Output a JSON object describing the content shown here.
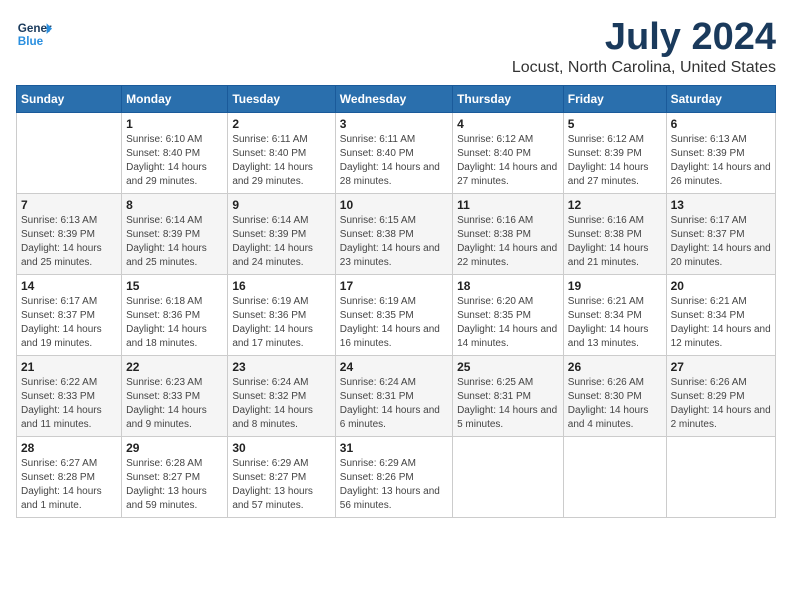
{
  "logo": {
    "line1": "General",
    "line2": "Blue"
  },
  "title": "July 2024",
  "subtitle": "Locust, North Carolina, United States",
  "days_header": [
    "Sunday",
    "Monday",
    "Tuesday",
    "Wednesday",
    "Thursday",
    "Friday",
    "Saturday"
  ],
  "weeks": [
    [
      {
        "num": "",
        "sunrise": "",
        "sunset": "",
        "daylight": ""
      },
      {
        "num": "1",
        "sunrise": "Sunrise: 6:10 AM",
        "sunset": "Sunset: 8:40 PM",
        "daylight": "Daylight: 14 hours and 29 minutes."
      },
      {
        "num": "2",
        "sunrise": "Sunrise: 6:11 AM",
        "sunset": "Sunset: 8:40 PM",
        "daylight": "Daylight: 14 hours and 29 minutes."
      },
      {
        "num": "3",
        "sunrise": "Sunrise: 6:11 AM",
        "sunset": "Sunset: 8:40 PM",
        "daylight": "Daylight: 14 hours and 28 minutes."
      },
      {
        "num": "4",
        "sunrise": "Sunrise: 6:12 AM",
        "sunset": "Sunset: 8:40 PM",
        "daylight": "Daylight: 14 hours and 27 minutes."
      },
      {
        "num": "5",
        "sunrise": "Sunrise: 6:12 AM",
        "sunset": "Sunset: 8:39 PM",
        "daylight": "Daylight: 14 hours and 27 minutes."
      },
      {
        "num": "6",
        "sunrise": "Sunrise: 6:13 AM",
        "sunset": "Sunset: 8:39 PM",
        "daylight": "Daylight: 14 hours and 26 minutes."
      }
    ],
    [
      {
        "num": "7",
        "sunrise": "Sunrise: 6:13 AM",
        "sunset": "Sunset: 8:39 PM",
        "daylight": "Daylight: 14 hours and 25 minutes."
      },
      {
        "num": "8",
        "sunrise": "Sunrise: 6:14 AM",
        "sunset": "Sunset: 8:39 PM",
        "daylight": "Daylight: 14 hours and 25 minutes."
      },
      {
        "num": "9",
        "sunrise": "Sunrise: 6:14 AM",
        "sunset": "Sunset: 8:39 PM",
        "daylight": "Daylight: 14 hours and 24 minutes."
      },
      {
        "num": "10",
        "sunrise": "Sunrise: 6:15 AM",
        "sunset": "Sunset: 8:38 PM",
        "daylight": "Daylight: 14 hours and 23 minutes."
      },
      {
        "num": "11",
        "sunrise": "Sunrise: 6:16 AM",
        "sunset": "Sunset: 8:38 PM",
        "daylight": "Daylight: 14 hours and 22 minutes."
      },
      {
        "num": "12",
        "sunrise": "Sunrise: 6:16 AM",
        "sunset": "Sunset: 8:38 PM",
        "daylight": "Daylight: 14 hours and 21 minutes."
      },
      {
        "num": "13",
        "sunrise": "Sunrise: 6:17 AM",
        "sunset": "Sunset: 8:37 PM",
        "daylight": "Daylight: 14 hours and 20 minutes."
      }
    ],
    [
      {
        "num": "14",
        "sunrise": "Sunrise: 6:17 AM",
        "sunset": "Sunset: 8:37 PM",
        "daylight": "Daylight: 14 hours and 19 minutes."
      },
      {
        "num": "15",
        "sunrise": "Sunrise: 6:18 AM",
        "sunset": "Sunset: 8:36 PM",
        "daylight": "Daylight: 14 hours and 18 minutes."
      },
      {
        "num": "16",
        "sunrise": "Sunrise: 6:19 AM",
        "sunset": "Sunset: 8:36 PM",
        "daylight": "Daylight: 14 hours and 17 minutes."
      },
      {
        "num": "17",
        "sunrise": "Sunrise: 6:19 AM",
        "sunset": "Sunset: 8:35 PM",
        "daylight": "Daylight: 14 hours and 16 minutes."
      },
      {
        "num": "18",
        "sunrise": "Sunrise: 6:20 AM",
        "sunset": "Sunset: 8:35 PM",
        "daylight": "Daylight: 14 hours and 14 minutes."
      },
      {
        "num": "19",
        "sunrise": "Sunrise: 6:21 AM",
        "sunset": "Sunset: 8:34 PM",
        "daylight": "Daylight: 14 hours and 13 minutes."
      },
      {
        "num": "20",
        "sunrise": "Sunrise: 6:21 AM",
        "sunset": "Sunset: 8:34 PM",
        "daylight": "Daylight: 14 hours and 12 minutes."
      }
    ],
    [
      {
        "num": "21",
        "sunrise": "Sunrise: 6:22 AM",
        "sunset": "Sunset: 8:33 PM",
        "daylight": "Daylight: 14 hours and 11 minutes."
      },
      {
        "num": "22",
        "sunrise": "Sunrise: 6:23 AM",
        "sunset": "Sunset: 8:33 PM",
        "daylight": "Daylight: 14 hours and 9 minutes."
      },
      {
        "num": "23",
        "sunrise": "Sunrise: 6:24 AM",
        "sunset": "Sunset: 8:32 PM",
        "daylight": "Daylight: 14 hours and 8 minutes."
      },
      {
        "num": "24",
        "sunrise": "Sunrise: 6:24 AM",
        "sunset": "Sunset: 8:31 PM",
        "daylight": "Daylight: 14 hours and 6 minutes."
      },
      {
        "num": "25",
        "sunrise": "Sunrise: 6:25 AM",
        "sunset": "Sunset: 8:31 PM",
        "daylight": "Daylight: 14 hours and 5 minutes."
      },
      {
        "num": "26",
        "sunrise": "Sunrise: 6:26 AM",
        "sunset": "Sunset: 8:30 PM",
        "daylight": "Daylight: 14 hours and 4 minutes."
      },
      {
        "num": "27",
        "sunrise": "Sunrise: 6:26 AM",
        "sunset": "Sunset: 8:29 PM",
        "daylight": "Daylight: 14 hours and 2 minutes."
      }
    ],
    [
      {
        "num": "28",
        "sunrise": "Sunrise: 6:27 AM",
        "sunset": "Sunset: 8:28 PM",
        "daylight": "Daylight: 14 hours and 1 minute."
      },
      {
        "num": "29",
        "sunrise": "Sunrise: 6:28 AM",
        "sunset": "Sunset: 8:27 PM",
        "daylight": "Daylight: 13 hours and 59 minutes."
      },
      {
        "num": "30",
        "sunrise": "Sunrise: 6:29 AM",
        "sunset": "Sunset: 8:27 PM",
        "daylight": "Daylight: 13 hours and 57 minutes."
      },
      {
        "num": "31",
        "sunrise": "Sunrise: 6:29 AM",
        "sunset": "Sunset: 8:26 PM",
        "daylight": "Daylight: 13 hours and 56 minutes."
      },
      {
        "num": "",
        "sunrise": "",
        "sunset": "",
        "daylight": ""
      },
      {
        "num": "",
        "sunrise": "",
        "sunset": "",
        "daylight": ""
      },
      {
        "num": "",
        "sunrise": "",
        "sunset": "",
        "daylight": ""
      }
    ]
  ]
}
